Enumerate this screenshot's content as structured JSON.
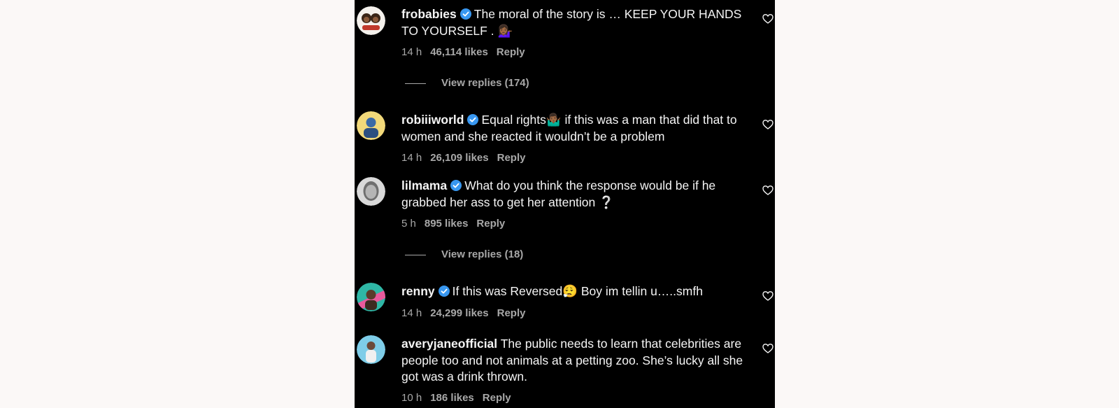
{
  "comments": [
    {
      "username": "frobabies",
      "verified": true,
      "text": "The moral of the story is … KEEP YOUR HANDS TO YOURSELF . 💁🏾‍♀️",
      "time": "14 h",
      "likes": "46,114 likes",
      "reply": "Reply",
      "view_replies": "View replies (174)"
    },
    {
      "username": "robiiiworld",
      "verified": true,
      "text": "Equal rights🤷🏾‍♂️ if this was a man that did that to women and she reacted it wouldn’t be a problem",
      "time": "14 h",
      "likes": "26,109 likes",
      "reply": "Reply"
    },
    {
      "username": "lilmama",
      "verified": true,
      "text": "What do you think the response would be if he grabbed her ass to get her attention ❔",
      "time": "5 h",
      "likes": "895 likes",
      "reply": "Reply",
      "view_replies": "View replies (18)"
    },
    {
      "username": "renny",
      "verified": true,
      "text": "If this was Reversed😮‍💨 Boy im tellin u…..smfh",
      "time": "14 h",
      "likes": "24,299 likes",
      "reply": "Reply"
    },
    {
      "username": "averyjaneofficial",
      "verified": false,
      "text": "The public needs to learn that celebrities are people too and not animals at a petting zoo. She’s lucky all she got was a drink thrown.",
      "time": "10 h",
      "likes": "186 likes",
      "reply": "Reply"
    }
  ],
  "icons": {
    "verified": "verified-badge-icon",
    "heart": "heart-outline-icon"
  },
  "colors": {
    "background": "#000000",
    "page": "#fbf8f7",
    "text": "#f5f5f5",
    "secondary_text": "#a8a8a8",
    "verified": "#3897f0"
  }
}
